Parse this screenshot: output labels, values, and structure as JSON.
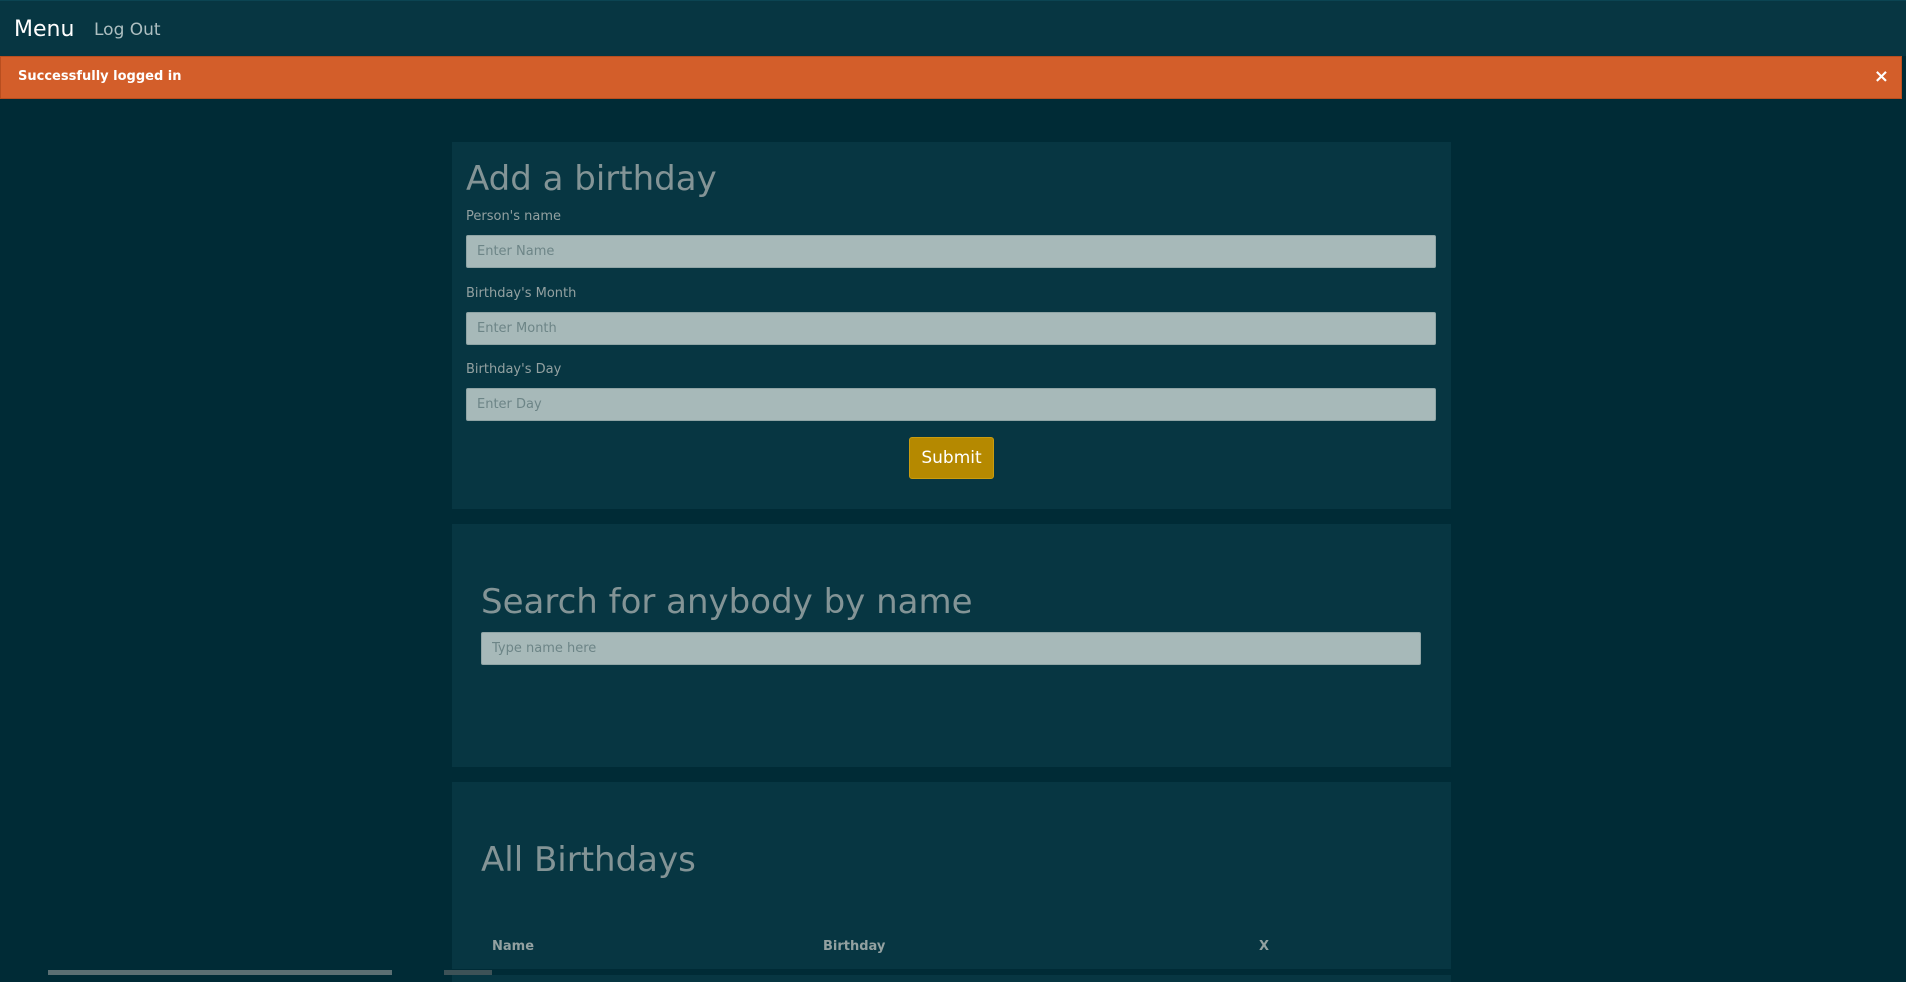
{
  "nav": {
    "brand": "Menu",
    "logout": "Log Out"
  },
  "alert": {
    "message": "Successfully logged in",
    "close": "×"
  },
  "add_form": {
    "title": "Add a birthday",
    "name_label": "Person's name",
    "name_placeholder": "Enter Name",
    "month_label": "Birthday's Month",
    "month_placeholder": "Enter Month",
    "day_label": "Birthday's Day",
    "day_placeholder": "Enter Day",
    "submit": "Submit"
  },
  "search": {
    "title": "Search for anybody by name",
    "placeholder": "Type name here"
  },
  "all_birthdays": {
    "title": "All Birthdays",
    "columns": [
      "Name",
      "Birthday",
      "X"
    ]
  },
  "colors": {
    "background": "#002b36",
    "panel": "#073642",
    "alert": "#d35e2a",
    "button": "#b58900"
  }
}
